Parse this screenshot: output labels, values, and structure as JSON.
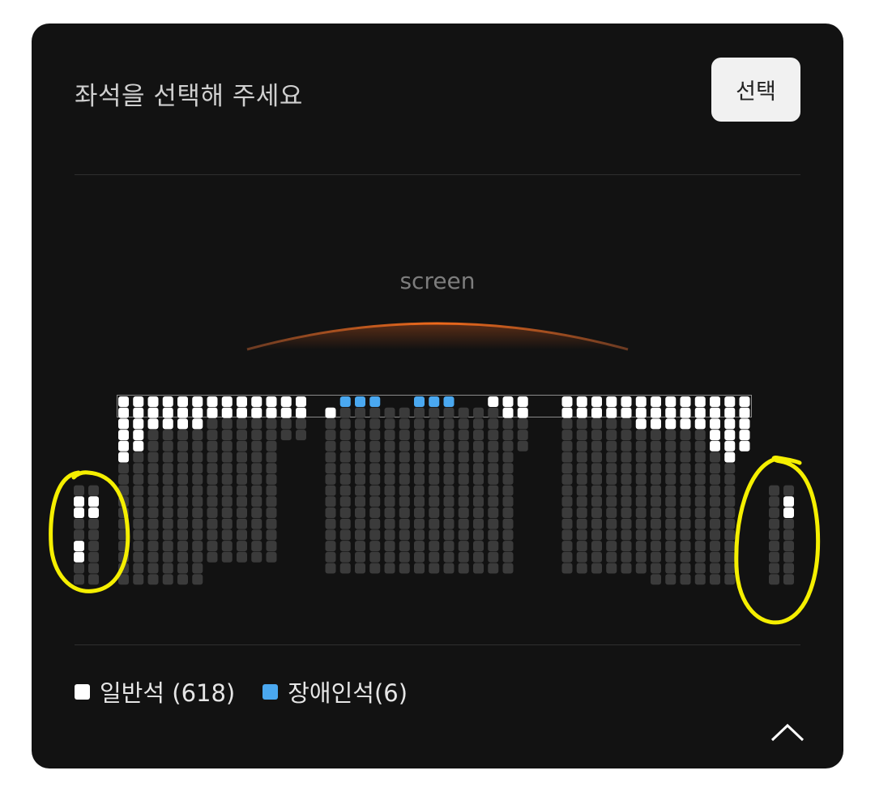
{
  "header": {
    "title": "좌석을 선택해 주세요",
    "select_label": "선택"
  },
  "screen": {
    "label": "screen"
  },
  "legend": [
    {
      "label": "일반석 (618)",
      "color": "#ffffff"
    },
    {
      "label": "장애인석(6)",
      "color": "#4aa8f0"
    }
  ],
  "colors": {
    "panel": "#121212",
    "available": "#ffffff",
    "accessible": "#4aa8f0",
    "sold": "#3b3b3b",
    "screen_glow": "#e0601e",
    "highlight_ring": "#f5ef00"
  },
  "icons": {
    "collapse": "chevron-up-icon"
  }
}
